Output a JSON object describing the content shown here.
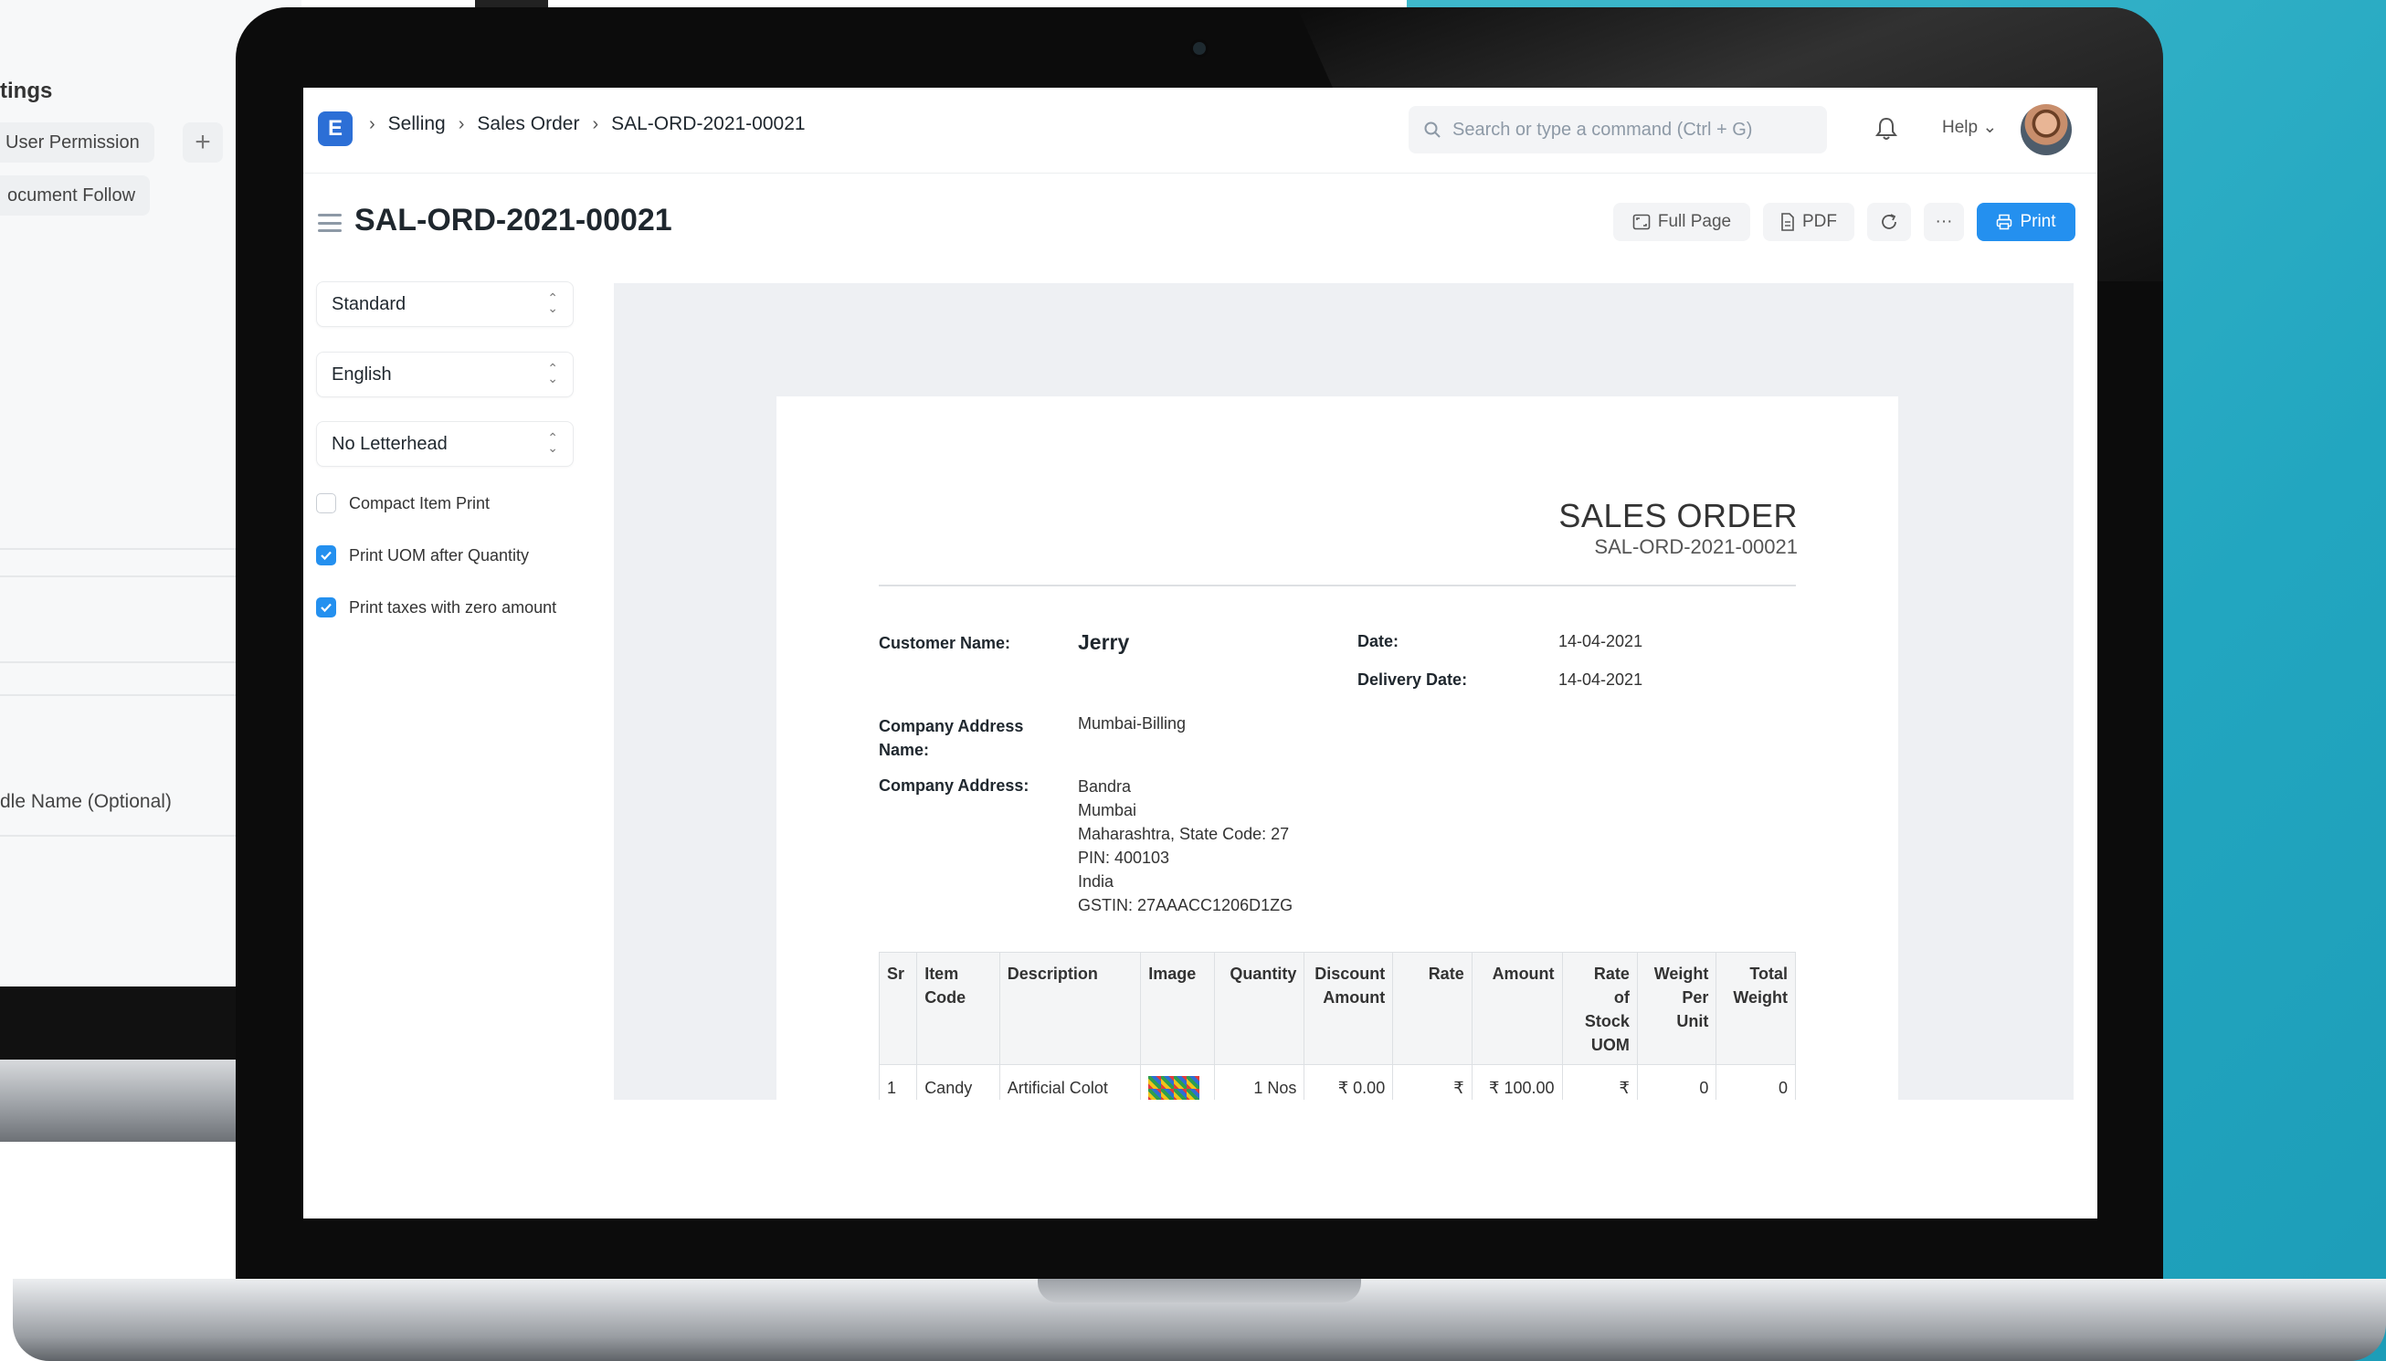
{
  "background_app": {
    "title_fragment": "tings",
    "chips": [
      "User Permission",
      "ocument Follow"
    ],
    "add_symbol": "+",
    "field_label": "dle Name (Optional)"
  },
  "navbar": {
    "logo_letter": "E",
    "breadcrumbs": [
      "Selling",
      "Sales Order",
      "SAL-ORD-2021-00021"
    ],
    "search_placeholder": "Search or type a command (Ctrl + G)",
    "help_label": "Help",
    "help_chevron": "⌄"
  },
  "page": {
    "title": "SAL-ORD-2021-00021",
    "buttons": {
      "full_page": "Full Page",
      "pdf": "PDF",
      "more": "···",
      "print": "Print"
    }
  },
  "sidebar": {
    "print_format": "Standard",
    "language": "English",
    "letterhead": "No Letterhead",
    "checkboxes": [
      {
        "label": "Compact Item Print",
        "checked": false
      },
      {
        "label": "Print UOM after Quantity",
        "checked": true
      },
      {
        "label": "Print taxes with zero amount",
        "checked": true
      }
    ]
  },
  "document": {
    "heading": "SALES ORDER",
    "number": "SAL-ORD-2021-00021",
    "customer_label": "Customer Name:",
    "customer": "Jerry",
    "date_label": "Date:",
    "date": "14-04-2021",
    "delivery_label": "Delivery Date:",
    "delivery_date": "14-04-2021",
    "company_address_name_label_1": "Company Address",
    "company_address_name_label_2": "Name:",
    "company_address_name": "Mumbai-Billing",
    "company_address_label": "Company Address:",
    "address_lines": [
      "Bandra",
      "Mumbai",
      "Maharashtra, State Code: 27",
      "PIN: 400103",
      "India",
      "GSTIN: 27AAACC1206D1ZG"
    ],
    "table": {
      "headers": [
        [
          "Sr"
        ],
        [
          "Item",
          "Code"
        ],
        [
          "Description"
        ],
        [
          "Image"
        ],
        [
          "Quantity"
        ],
        [
          "Discount",
          "Amount"
        ],
        [
          "Rate"
        ],
        [
          "Amount"
        ],
        [
          "Rate",
          "of",
          "Stock",
          "UOM"
        ],
        [
          "Weight",
          "Per",
          "Unit"
        ],
        [
          "Total",
          "Weight"
        ]
      ],
      "rows": [
        {
          "sr": "1",
          "item_code": "Candy",
          "description": "Artificial Colot",
          "quantity": "1 Nos",
          "discount_amount": "₹ 0.00",
          "rate": "₹",
          "amount": "₹ 100.00",
          "rate_stock_uom": "₹",
          "weight_per_unit": "0",
          "total_weight": "0"
        }
      ]
    }
  },
  "colors": {
    "primary": "#2490ef",
    "logo": "#2c6fd6",
    "teal_background": "#22a6c0"
  },
  "icons": [
    "search-icon",
    "bell-icon",
    "fullpage-icon",
    "pdf-icon",
    "refresh-icon",
    "printer-icon",
    "hamburger-icon",
    "check-icon"
  ]
}
